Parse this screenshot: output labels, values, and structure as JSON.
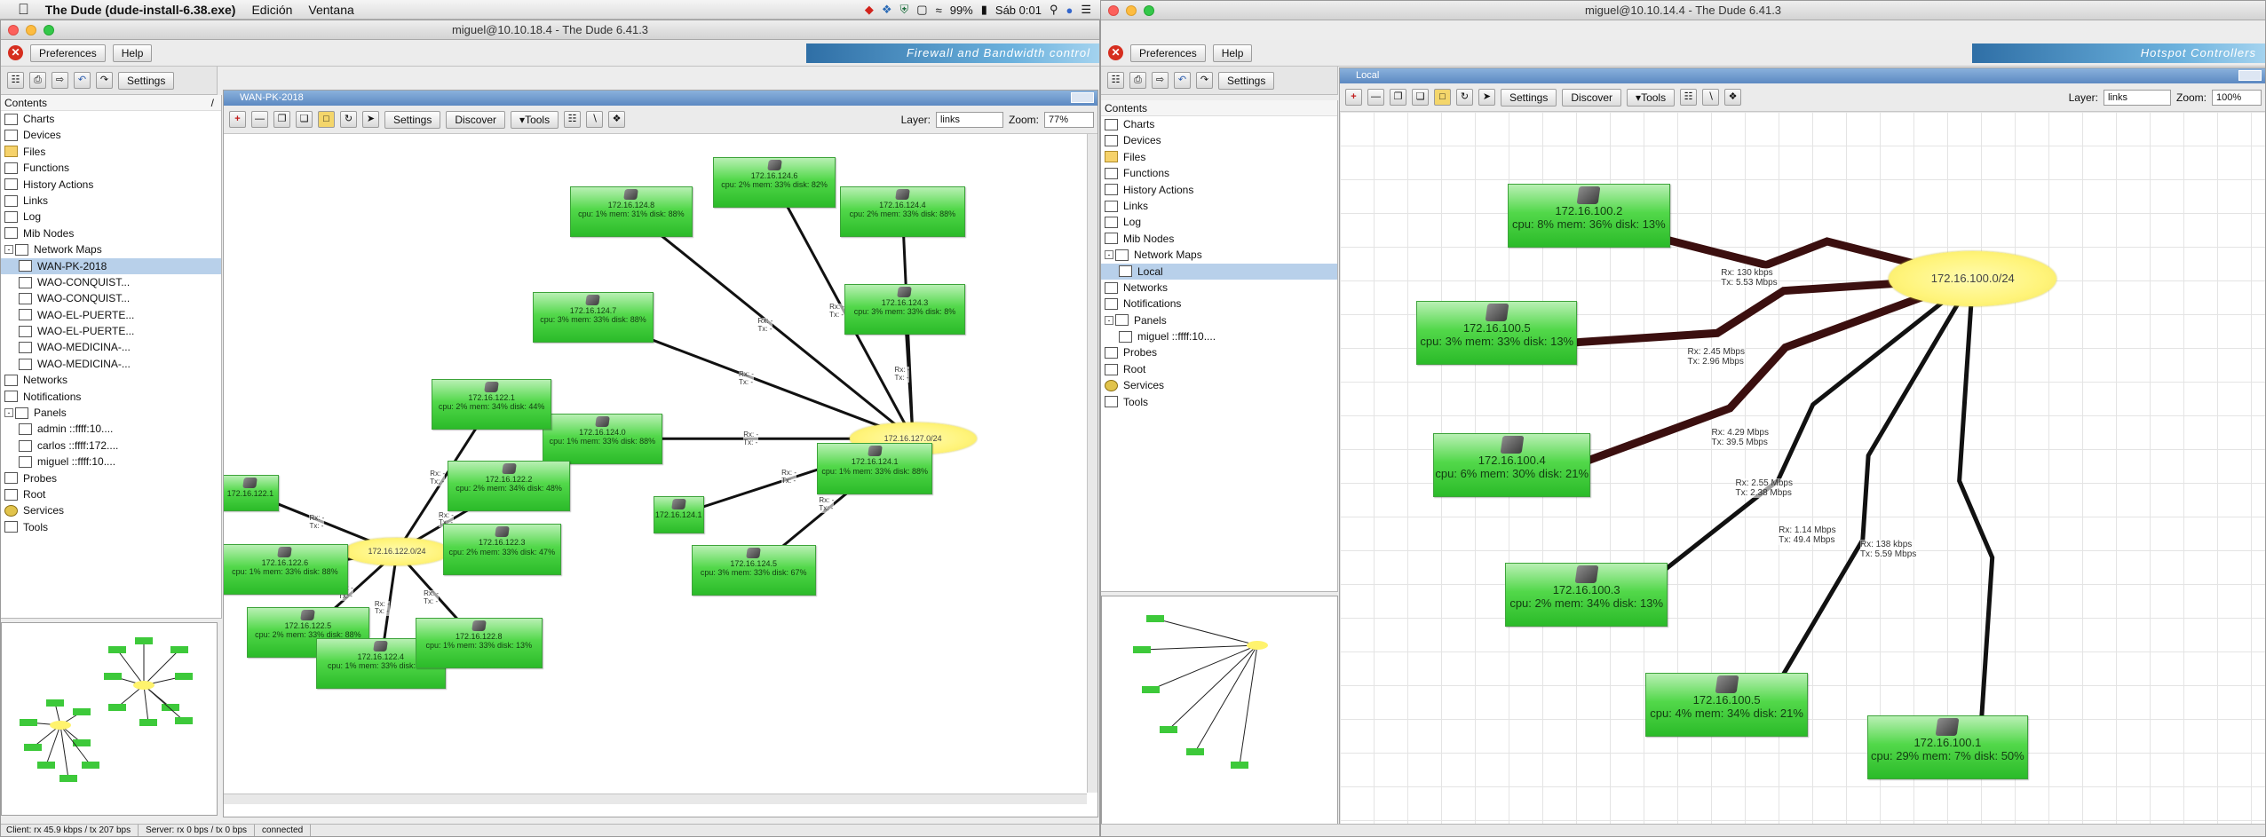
{
  "menubar": {
    "app_name": "The Dude (dude-install-6.38.exe)",
    "menus": [
      "Edición",
      "Ventana"
    ],
    "battery": "99%",
    "clock": "Sáb 0:01"
  },
  "left": {
    "window_title": "miguel@10.10.18.4 - The Dude 6.41.3",
    "preferences_label": "Preferences",
    "help_label": "Help",
    "banner": "Firewall and Bandwidth control",
    "settings_label": "Settings",
    "contents_label": "Contents",
    "tree": [
      {
        "label": "Charts",
        "icon": "chart"
      },
      {
        "label": "Devices",
        "icon": "device"
      },
      {
        "label": "Files",
        "icon": "folder"
      },
      {
        "label": "Functions",
        "icon": "fn"
      },
      {
        "label": "History Actions",
        "icon": "history"
      },
      {
        "label": "Links",
        "icon": "links"
      },
      {
        "label": "Log",
        "icon": "log"
      },
      {
        "label": "Mib Nodes",
        "icon": "mib"
      },
      {
        "label": "Network Maps",
        "icon": "map",
        "expander": "-"
      },
      {
        "label": "WAN-PK-2018",
        "icon": "map",
        "indent": 1,
        "selected": true
      },
      {
        "label": "WAO-CONQUIST...",
        "icon": "map",
        "indent": 1
      },
      {
        "label": "WAO-CONQUIST...",
        "icon": "map",
        "indent": 1
      },
      {
        "label": "WAO-EL-PUERTE...",
        "icon": "map",
        "indent": 1
      },
      {
        "label": "WAO-EL-PUERTE...",
        "icon": "map",
        "indent": 1
      },
      {
        "label": "WAO-MEDICINA-...",
        "icon": "map",
        "indent": 1
      },
      {
        "label": "WAO-MEDICINA-...",
        "icon": "map",
        "indent": 1
      },
      {
        "label": "Networks",
        "icon": "net"
      },
      {
        "label": "Notifications",
        "icon": "notif"
      },
      {
        "label": "Panels",
        "icon": "panel",
        "expander": "-"
      },
      {
        "label": "admin ::ffff:10....",
        "icon": "panel",
        "indent": 1
      },
      {
        "label": "carlos ::ffff:172....",
        "icon": "panel",
        "indent": 1
      },
      {
        "label": "miguel ::ffff:10....",
        "icon": "panel",
        "indent": 1
      },
      {
        "label": "Probes",
        "icon": "probe"
      },
      {
        "label": "Root",
        "icon": "root"
      },
      {
        "label": "Services",
        "icon": "gear"
      },
      {
        "label": "Tools",
        "icon": "tools"
      }
    ],
    "map_title": "WAN-PK-2018",
    "map_toolbar": {
      "settings": "Settings",
      "discover": "Discover",
      "tools": "Tools",
      "layer_label": "Layer:",
      "layer_value": "links",
      "zoom_label": "Zoom:",
      "zoom_value": "77%"
    },
    "clouds": [
      {
        "id": "c1",
        "label": "172.16.127.0/24"
      },
      {
        "id": "c2",
        "label": "172.16.122.0/24"
      }
    ],
    "nodes": [
      {
        "id": "n1",
        "ip": "172.16.124.8",
        "stats": "cpu: 1% mem: 31% disk: 88%"
      },
      {
        "id": "n2",
        "ip": "172.16.124.6",
        "stats": "cpu: 2% mem: 33% disk: 82%"
      },
      {
        "id": "n3",
        "ip": "172.16.124.4",
        "stats": "cpu: 2% mem: 33% disk: 88%"
      },
      {
        "id": "n4",
        "ip": "172.16.124.3",
        "stats": "cpu: 3% mem: 33% disk: 8%"
      },
      {
        "id": "n5",
        "ip": "172.16.124.7",
        "stats": "cpu: 3% mem: 33% disk: 88%"
      },
      {
        "id": "n6",
        "ip": "172.16.124.0",
        "stats": "cpu: 1% mem: 33% disk: 88%"
      },
      {
        "id": "n7",
        "ip": "172.16.124.1",
        "stats": "cpu: 1% mem: 33% disk: 88%"
      },
      {
        "id": "n8",
        "ip": "172.16.124.1",
        "stats": ""
      },
      {
        "id": "n9",
        "ip": "172.16.124.5",
        "stats": "cpu: 3% mem: 33% disk: 67%"
      },
      {
        "id": "n10",
        "ip": "172.16.122.1",
        "stats": "cpu: 2% mem: 34% disk: 44%"
      },
      {
        "id": "n11",
        "ip": "172.16.122.1",
        "stats": ""
      },
      {
        "id": "n12",
        "ip": "172.16.122.2",
        "stats": "cpu: 2% mem: 34% disk: 48%"
      },
      {
        "id": "n13",
        "ip": "172.16.122.6",
        "stats": "cpu: 1% mem: 33% disk: 88%"
      },
      {
        "id": "n14",
        "ip": "172.16.122.3",
        "stats": "cpu: 2% mem: 33% disk: 47%"
      },
      {
        "id": "n15",
        "ip": "172.16.122.5",
        "stats": "cpu: 2% mem: 33% disk: 88%"
      },
      {
        "id": "n16",
        "ip": "172.16.122.4",
        "stats": "cpu: 1% mem: 33% disk: 88%"
      },
      {
        "id": "n17",
        "ip": "172.16.122.8",
        "stats": "cpu: 1% mem: 33% disk: 13%"
      }
    ],
    "status": {
      "client": "Client: rx 45.9 kbps / tx 207 bps",
      "server": "Server: rx 0 bps / tx 0 bps",
      "state": "connected"
    }
  },
  "right": {
    "window_title": "miguel@10.10.14.4 - The Dude 6.41.3",
    "preferences_label": "Preferences",
    "help_label": "Help",
    "banner": "Hotspot Controllers",
    "settings_label": "Settings",
    "contents_label": "Contents",
    "tree": [
      {
        "label": "Charts",
        "icon": "chart"
      },
      {
        "label": "Devices",
        "icon": "device"
      },
      {
        "label": "Files",
        "icon": "folder"
      },
      {
        "label": "Functions",
        "icon": "fn"
      },
      {
        "label": "History Actions",
        "icon": "history"
      },
      {
        "label": "Links",
        "icon": "links"
      },
      {
        "label": "Log",
        "icon": "log"
      },
      {
        "label": "Mib Nodes",
        "icon": "mib"
      },
      {
        "label": "Network Maps",
        "icon": "map",
        "expander": "-"
      },
      {
        "label": "Local",
        "icon": "map",
        "indent": 1,
        "selected": true
      },
      {
        "label": "Networks",
        "icon": "net"
      },
      {
        "label": "Notifications",
        "icon": "notif"
      },
      {
        "label": "Panels",
        "icon": "panel",
        "expander": "-"
      },
      {
        "label": "miguel ::ffff:10....",
        "icon": "panel",
        "indent": 1
      },
      {
        "label": "Probes",
        "icon": "probe"
      },
      {
        "label": "Root",
        "icon": "root"
      },
      {
        "label": "Services",
        "icon": "gear"
      },
      {
        "label": "Tools",
        "icon": "tools"
      }
    ],
    "map_title": "Local",
    "map_toolbar": {
      "settings": "Settings",
      "discover": "Discover",
      "tools": "Tools",
      "layer_label": "Layer:",
      "layer_value": "links",
      "zoom_label": "Zoom:",
      "zoom_value": "100%"
    },
    "cloud": {
      "label": "172.16.100.0/24"
    },
    "nodes": [
      {
        "id": "r1",
        "ip": "172.16.100.2",
        "stats": "cpu: 8% mem: 36% disk: 13%"
      },
      {
        "id": "r2",
        "ip": "172.16.100.5",
        "stats": "cpu: 3% mem: 33% disk: 13%"
      },
      {
        "id": "r3",
        "ip": "172.16.100.4",
        "stats": "cpu: 6% mem: 30% disk: 21%"
      },
      {
        "id": "r4",
        "ip": "172.16.100.3",
        "stats": "cpu: 2% mem: 34% disk: 13%"
      },
      {
        "id": "r5",
        "ip": "172.16.100.5",
        "stats": "cpu: 4% mem: 34% disk: 21%"
      },
      {
        "id": "r6",
        "ip": "172.16.100.1",
        "stats": "cpu: 29% mem: 7% disk: 50%"
      }
    ],
    "links": [
      {
        "id": "rl1",
        "text": "Rx: 130 kbps\nTx: 5.53 Mbps"
      },
      {
        "id": "rl2",
        "text": "Rx: 2.45 Mbps\nTx: 2.96 Mbps"
      },
      {
        "id": "rl3",
        "text": "Rx: 4.29 Mbps\nTx: 39.5 Mbps"
      },
      {
        "id": "rl4",
        "text": "Rx: 2.55 Mbps\nTx: 2.38 Mbps"
      },
      {
        "id": "rl5",
        "text": "Rx: 1.14 Mbps\nTx: 49.4 Mbps"
      },
      {
        "id": "rl6",
        "text": "Rx: 138 kbps\nTx: 5.59 Mbps"
      }
    ]
  }
}
